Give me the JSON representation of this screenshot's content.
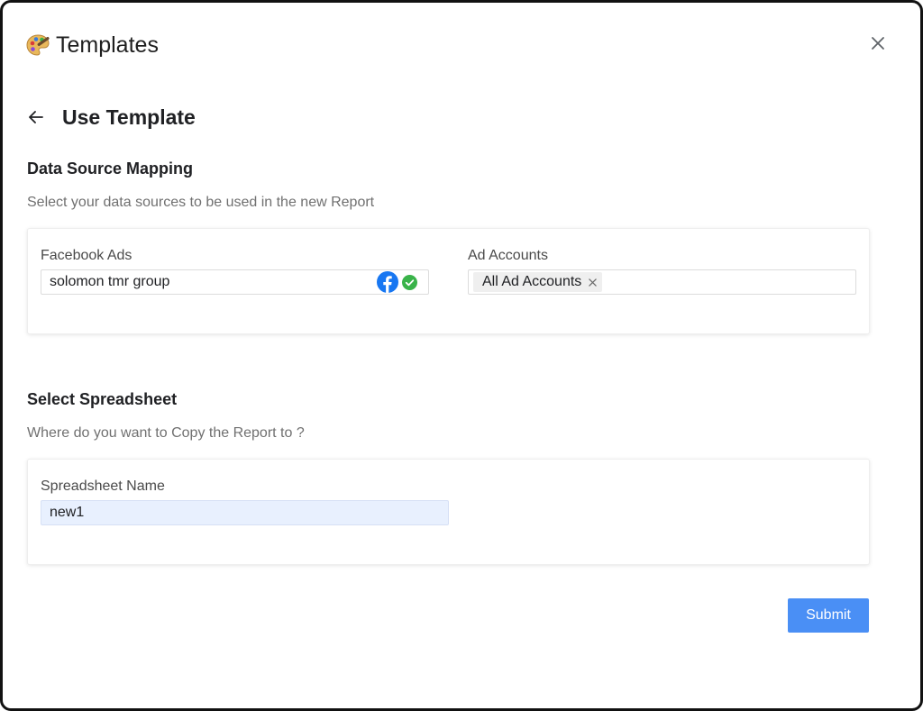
{
  "dialog": {
    "title": "Templates",
    "icons": {
      "title_icon": "palette-icon",
      "close": "close-icon",
      "back": "arrow-left-icon"
    }
  },
  "page": {
    "title": "Use Template"
  },
  "data_source_mapping": {
    "title": "Data Source Mapping",
    "subtitle": "Select your data sources to be used in the new Report",
    "facebook_ads": {
      "label": "Facebook Ads",
      "value": "solomon tmr group",
      "icons": [
        "facebook-icon",
        "check-circle-icon"
      ]
    },
    "ad_accounts": {
      "label": "Ad Accounts",
      "chips": [
        {
          "label": "All Ad Accounts"
        }
      ]
    }
  },
  "select_spreadsheet": {
    "title": "Select Spreadsheet",
    "subtitle": "Where do you want to Copy the Report to ?",
    "spreadsheet_name": {
      "label": "Spreadsheet Name",
      "value": "new1"
    }
  },
  "actions": {
    "submit_label": "Submit"
  },
  "colors": {
    "primary_button": "#4a8ff5",
    "facebook_blue": "#1877f2",
    "success_green": "#3ab34a",
    "input_highlight": "#e8f0fe"
  }
}
